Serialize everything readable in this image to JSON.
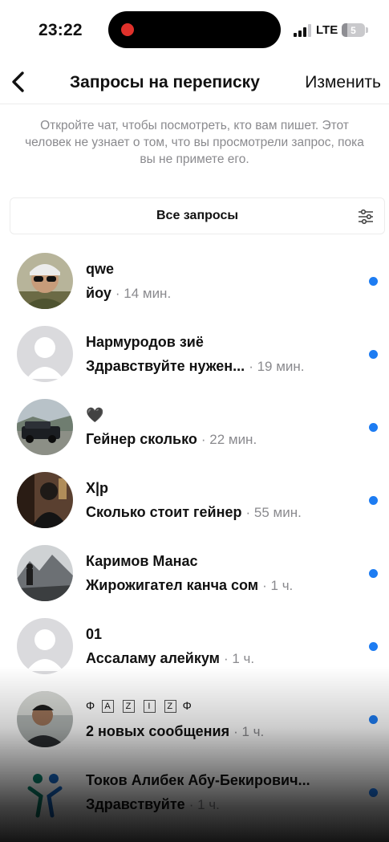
{
  "status_bar": {
    "time": "23:22",
    "network": "LTE",
    "battery": "5"
  },
  "header": {
    "back_icon": "chevron-left-icon",
    "title": "Запросы на переписку",
    "edit_label": "Изменить"
  },
  "info_text": "Откройте чат, чтобы посмотреть, кто вам пишет. Этот человек не узнает о том, что вы просмотрели запрос, пока вы не примете его.",
  "filter": {
    "label": "Все запросы",
    "icon": "sliders-icon"
  },
  "requests": [
    {
      "name": "qwe",
      "message": "йоу",
      "time": "· 14 мин.",
      "unread": true
    },
    {
      "name": "Нармуродов зиё",
      "message": "Здравствуйте нужен...",
      "time": "· 19 мин.",
      "unread": true
    },
    {
      "name": "🖤",
      "message": "Гейнер сколько",
      "time": "· 22 мин.",
      "unread": true
    },
    {
      "name": "X|p",
      "message": "Сколько стоит гейнер",
      "time": "· 55 мин.",
      "unread": true
    },
    {
      "name": "Каримов Манас",
      "message": "Жирожигател канча сом",
      "time": "· 1 ч.",
      "unread": true
    },
    {
      "name": "01",
      "message": "Ассаламу алейкум",
      "time": "· 1 ч.",
      "unread": true
    },
    {
      "name_parts": [
        "Φ",
        "A",
        "Z",
        "I",
        "Z",
        "Φ"
      ],
      "message": "2 новых сообщения",
      "time": "· 1 ч.",
      "unread": true
    },
    {
      "name": "Токов Алибек Абу-Бекирович...",
      "message": "Здравствуйте",
      "time": "· 1 ч.",
      "unread": true
    }
  ],
  "colors": {
    "accent": "#1d7cf2",
    "secondary_text": "#8a8a8e",
    "recording": "#e0312b"
  }
}
